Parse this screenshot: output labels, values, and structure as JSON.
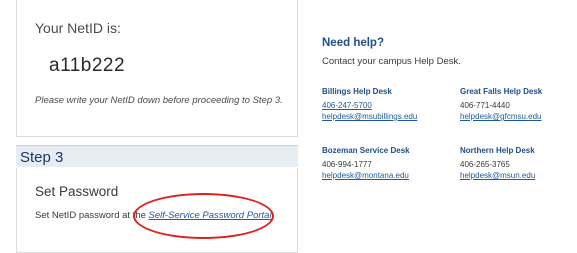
{
  "netid": {
    "label": "Your NetID is:",
    "value": "a11b222",
    "note": "Please write your NetID down before proceeding to Step 3."
  },
  "step": {
    "title": "Step 3"
  },
  "password": {
    "heading": "Set Password",
    "text": "Set NetID password at the ",
    "link": "Self-Service Password Portal"
  },
  "help": {
    "title": "Need help?",
    "subtitle": "Contact your campus Help Desk.",
    "desks": [
      {
        "name": "Billings Help Desk",
        "phone": "406-247-5700",
        "email": "helpdesk@msubillings.edu",
        "phone_is_link": true
      },
      {
        "name": "Great Falls Help Desk",
        "phone": "406-771-4440",
        "email": "helpdesk@gfcmsu.edu",
        "phone_is_link": false
      },
      {
        "name": "Bozeman Service Desk",
        "phone": "406-994-1777",
        "email": "helpdesk@montana.edu",
        "phone_is_link": false
      },
      {
        "name": "Northern Help Desk",
        "phone": "406-265-3765",
        "email": "helpdesk@msun.edu",
        "phone_is_link": false
      }
    ]
  },
  "annotation": {
    "color": "#e0201c"
  }
}
